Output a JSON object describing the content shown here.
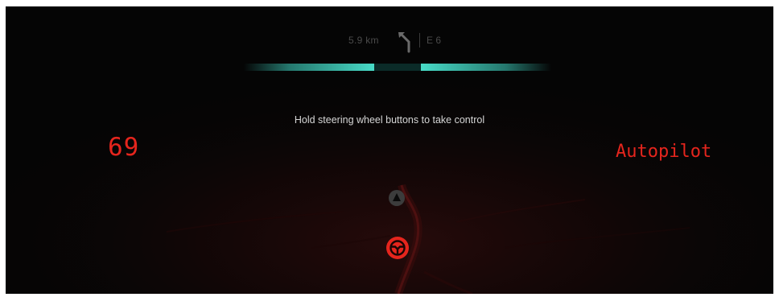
{
  "navigation": {
    "distance": "5.9 km",
    "road": "E 6",
    "turn_icon": "sharp-left-turn-arrow-icon"
  },
  "lane_guidance": {
    "color": "#48dcc8"
  },
  "message": {
    "text": "Hold steering wheel buttons to take control"
  },
  "speed": {
    "value": "69",
    "color": "#e5251d"
  },
  "drive_mode": {
    "label": "Autopilot",
    "color": "#e5251d"
  },
  "icons": {
    "car_marker": "car-position-marker-icon",
    "steering": "steering-wheel-icon"
  }
}
